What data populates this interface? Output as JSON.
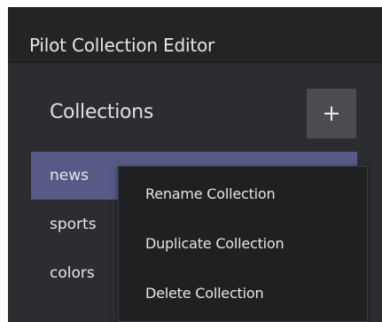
{
  "window": {
    "title": "Pilot Collection Editor"
  },
  "collections": {
    "header": "Collections",
    "add_icon": "plus-icon",
    "items": [
      {
        "label": "news",
        "selected": true
      },
      {
        "label": "sports",
        "selected": false
      },
      {
        "label": "colors",
        "selected": false
      }
    ]
  },
  "context_menu": {
    "items": [
      {
        "label": "Rename Collection"
      },
      {
        "label": "Duplicate Collection"
      },
      {
        "label": "Delete Collection"
      }
    ]
  },
  "colors": {
    "panel_bg": "#2b2d30",
    "title_bg": "#232426",
    "selected_bg": "#575a86",
    "menu_bg": "#1f2022"
  }
}
